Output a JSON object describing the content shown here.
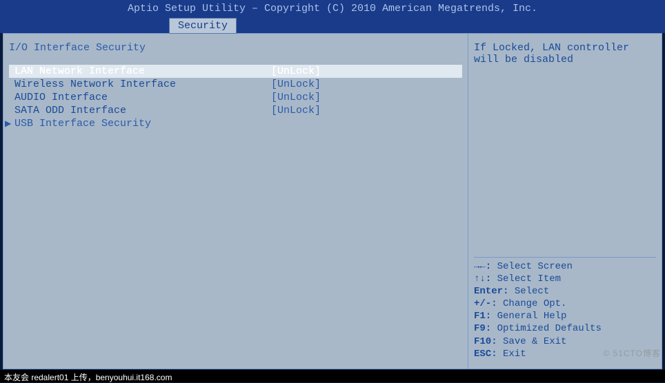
{
  "header": {
    "title": "Aptio Setup Utility – Copyright (C) 2010 American Megatrends, Inc."
  },
  "tab": {
    "label": "Security"
  },
  "section": {
    "title": "I/O Interface Security"
  },
  "settings": [
    {
      "label": "LAN Network Interface",
      "value": "[UnLock]",
      "selected": true
    },
    {
      "label": "Wireless Network Interface",
      "value": "[UnLock]",
      "selected": false
    },
    {
      "label": "AUDIO Interface",
      "value": "[UnLock]",
      "selected": false
    },
    {
      "label": "SATA ODD Interface",
      "value": "[UnLock]",
      "selected": false
    }
  ],
  "submenu": {
    "label": "USB Interface Security"
  },
  "help": {
    "text": "If Locked, LAN controller will be disabled"
  },
  "keys": [
    {
      "key": "→←:",
      "desc": "Select Screen"
    },
    {
      "key": "↑↓:",
      "desc": "Select Item"
    },
    {
      "key": "Enter:",
      "desc": "Select"
    },
    {
      "key": "+/-:",
      "desc": "Change Opt."
    },
    {
      "key": "F1:",
      "desc": "General Help"
    },
    {
      "key": "F9:",
      "desc": "Optimized Defaults"
    },
    {
      "key": "F10:",
      "desc": "Save & Exit"
    },
    {
      "key": "ESC:",
      "desc": "Exit"
    }
  ],
  "watermark": "© 51CTO博客",
  "caption": "本友会 redalert01 上传，benyouhui.it168.com"
}
